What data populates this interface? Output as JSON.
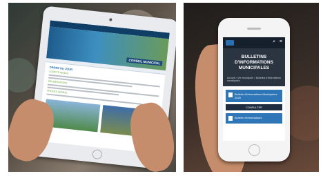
{
  "tablet_site": {
    "title": "CONSEIL MUNICIPAL",
    "heading": "ORDRE DU JOUR",
    "subheads": [
      "COMPTE RENDU",
      "DÉLIBÉRATIONS",
      "PROCÈS VERBAL"
    ]
  },
  "phone_site": {
    "hero_title": "BULLETINS D'INFORMATIONS MUNICIPALES",
    "breadcrumb": "Accueil  >  Vie municipale  >  Bulletins d'informations municipales",
    "cards": [
      {
        "title": "Bulletin d'Informations Municipales 2020",
        "button": "CONSULTER"
      },
      {
        "title": "Bulletin d'Informations",
        "button": ""
      }
    ]
  },
  "colors": {
    "primary": "#1d69a8",
    "accent_green": "#66aa33",
    "dark": "#1f2a38",
    "card": "#2e76b8"
  }
}
